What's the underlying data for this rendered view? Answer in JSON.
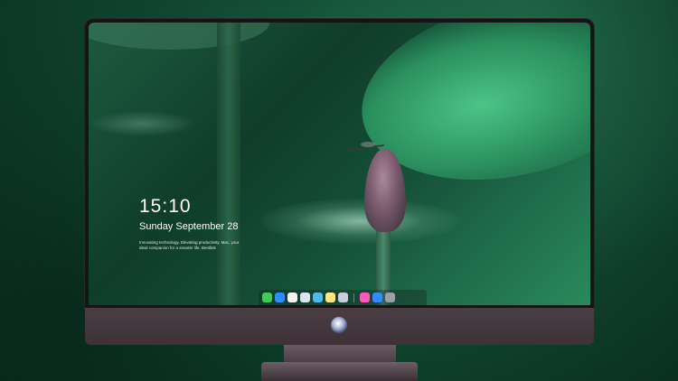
{
  "lockscreen": {
    "time": "15:10",
    "date": "Sunday September 28",
    "slogan": "Innovating technology, Elevating productivity. Mac, your ideal companion for a smarter life. Bestlink"
  },
  "dock": {
    "apps": [
      {
        "name": "messages-icon",
        "color": "#3ecb5a"
      },
      {
        "name": "finder-icon",
        "color": "#2f8bff"
      },
      {
        "name": "clock-icon",
        "color": "#f2f2f2"
      },
      {
        "name": "preview-icon",
        "color": "#d9e6ef"
      },
      {
        "name": "clapper-icon",
        "color": "#4fb9e9"
      },
      {
        "name": "notes-icon",
        "color": "#ffe680"
      },
      {
        "name": "photos-icon",
        "color": "#c5d0da"
      },
      {
        "name": "music-icon",
        "color": "#fb5ab9"
      },
      {
        "name": "app-store-icon",
        "color": "#2e8cff"
      },
      {
        "name": "camera-icon",
        "color": "#9aa0a8"
      }
    ]
  }
}
